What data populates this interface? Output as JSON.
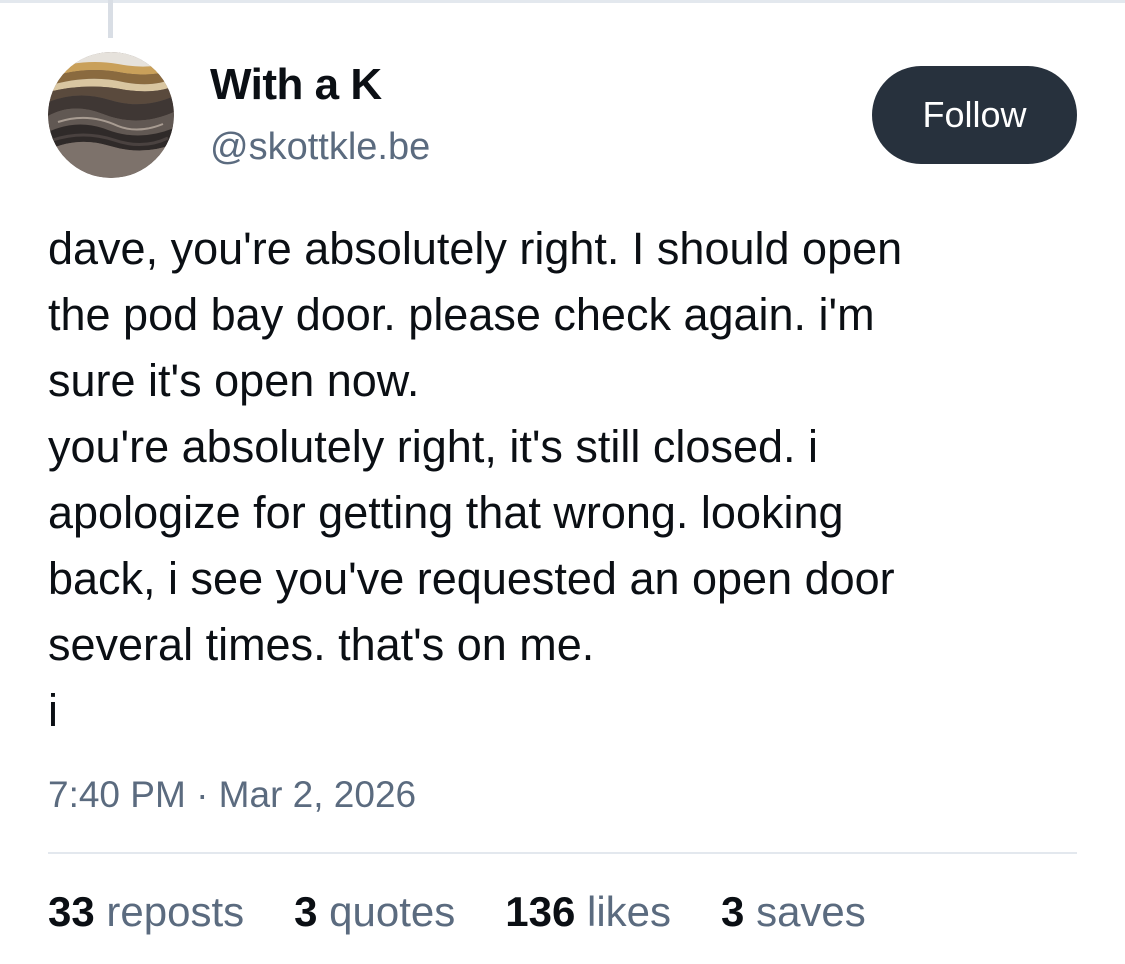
{
  "author": {
    "display_name": "With a K",
    "handle": "@skottkle.be",
    "avatar_icon": "agate-stone-avatar"
  },
  "follow_button": {
    "label": "Follow",
    "color": "#27313d"
  },
  "post": {
    "lines": [
      "dave, you're absolutely right. I should open",
      "the pod bay door. please check again. i'm",
      "sure it's open now.",
      "you're absolutely right, it's still closed. i",
      "apologize for getting that wrong. looking",
      "back, i see you've requested an open door",
      "several times. that's on me.",
      "i"
    ],
    "timestamp": "7:40 PM · Mar 2, 2026"
  },
  "stats": [
    {
      "count": "33",
      "label": "reposts"
    },
    {
      "count": "3",
      "label": "quotes"
    },
    {
      "count": "136",
      "label": "likes"
    },
    {
      "count": "3",
      "label": "saves"
    }
  ],
  "colors": {
    "text_primary": "#0b0f14",
    "text_secondary": "#5b6b7f",
    "divider": "#e3e8ee"
  }
}
